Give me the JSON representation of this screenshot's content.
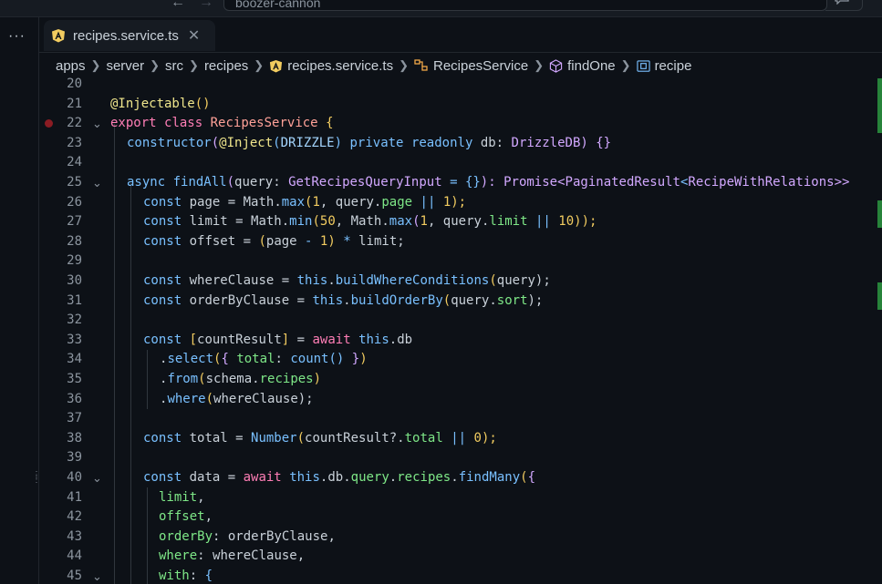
{
  "titlebar": {
    "search_text": "boozer-cannon"
  },
  "tab": {
    "label": "recipes.service.ts",
    "close": "✕"
  },
  "sidebar": {
    "more": "···"
  },
  "breadcrumb": [
    "apps",
    "server",
    "src",
    "recipes",
    "recipes.service.ts",
    "RecipesService",
    "findOne",
    "recipe"
  ],
  "colors": {
    "background": "#0d1117",
    "keyword": "#ff7eb6",
    "function": "#79c0ff",
    "property": "#7ee787",
    "number": "#f2cc60",
    "type": "#d2a8ff",
    "breakpoint": "#8b1c23"
  },
  "lines": [
    {
      "n": "20"
    },
    {
      "n": "21"
    },
    {
      "n": "22"
    },
    {
      "n": "23"
    },
    {
      "n": "24"
    },
    {
      "n": "25"
    },
    {
      "n": "26"
    },
    {
      "n": "27"
    },
    {
      "n": "28"
    },
    {
      "n": "29"
    },
    {
      "n": "30"
    },
    {
      "n": "31"
    },
    {
      "n": "32"
    },
    {
      "n": "33"
    },
    {
      "n": "34"
    },
    {
      "n": "35"
    },
    {
      "n": "36"
    },
    {
      "n": "37"
    },
    {
      "n": "38"
    },
    {
      "n": "39"
    },
    {
      "n": "40"
    },
    {
      "n": "41"
    },
    {
      "n": "42"
    },
    {
      "n": "43"
    },
    {
      "n": "44"
    },
    {
      "n": "45"
    }
  ],
  "code": {
    "l21": [
      "@Injectable",
      "()"
    ],
    "l22": [
      "export",
      " ",
      "class",
      " ",
      "RecipesService",
      " ",
      "{"
    ],
    "l23": [
      "constructor",
      "(",
      "@Inject",
      "(",
      "DRIZZLE",
      ") ",
      "private",
      " ",
      "readonly",
      " ",
      "db",
      ": ",
      "DrizzleDB",
      ") ",
      "{}"
    ],
    "l25": [
      "async",
      " ",
      "findAll",
      "(",
      "query",
      ": ",
      "GetRecipesQueryInput",
      " = ",
      "{}",
      "): ",
      "Promise",
      "<",
      "PaginatedResult",
      "<",
      "RecipeWithRelations",
      ">>"
    ],
    "l26": [
      "const",
      " page = ",
      "Math",
      ".",
      "max",
      "(",
      "1",
      ", query.",
      "page",
      " ",
      "||",
      " ",
      "1",
      ");"
    ],
    "l27": [
      "const",
      " limit = ",
      "Math",
      ".",
      "min",
      "(",
      "50",
      ", ",
      "Math",
      ".",
      "max",
      "(",
      "1",
      ", query.",
      "limit",
      " ",
      "||",
      " ",
      "10",
      "));"
    ],
    "l28": [
      "const",
      " offset = ",
      "(",
      "page ",
      "-",
      " ",
      "1",
      ")",
      " ",
      "*",
      " limit;"
    ],
    "l30": [
      "const",
      " whereClause = ",
      "this",
      ".",
      "buildWhereConditions",
      "(",
      "query",
      ");"
    ],
    "l31": [
      "const",
      " orderByClause = ",
      "this",
      ".",
      "buildOrderBy",
      "(",
      "query.",
      "sort",
      ");"
    ],
    "l33": [
      "const",
      " ",
      "[",
      "countResult",
      "]",
      " = ",
      "await",
      " ",
      "this",
      ".",
      "db"
    ],
    "l34": [
      ".",
      "select",
      "(",
      "{",
      " ",
      "total",
      ": ",
      "count",
      "()",
      " ",
      "}",
      ")"
    ],
    "l35": [
      ".",
      "from",
      "(",
      "schema.",
      "recipes",
      ")"
    ],
    "l36": [
      ".",
      "where",
      "(",
      "whereClause",
      ");"
    ],
    "l38": [
      "const",
      " total = ",
      "Number",
      "(",
      "countResult?.",
      "total",
      " ",
      "||",
      " ",
      "0",
      ");"
    ],
    "l40": [
      "const",
      " data = ",
      "await",
      " ",
      "this",
      ".",
      "db",
      ".",
      "query",
      ".",
      "recipes",
      ".",
      "findMany",
      "(",
      "{"
    ],
    "l41": [
      "limit",
      ","
    ],
    "l42": [
      "offset",
      ","
    ],
    "l43": [
      "orderBy",
      ": ",
      "orderByClause",
      ","
    ],
    "l44": [
      "where",
      ": ",
      "whereClause",
      ","
    ],
    "l45": [
      "with",
      ": ",
      "{"
    ]
  }
}
